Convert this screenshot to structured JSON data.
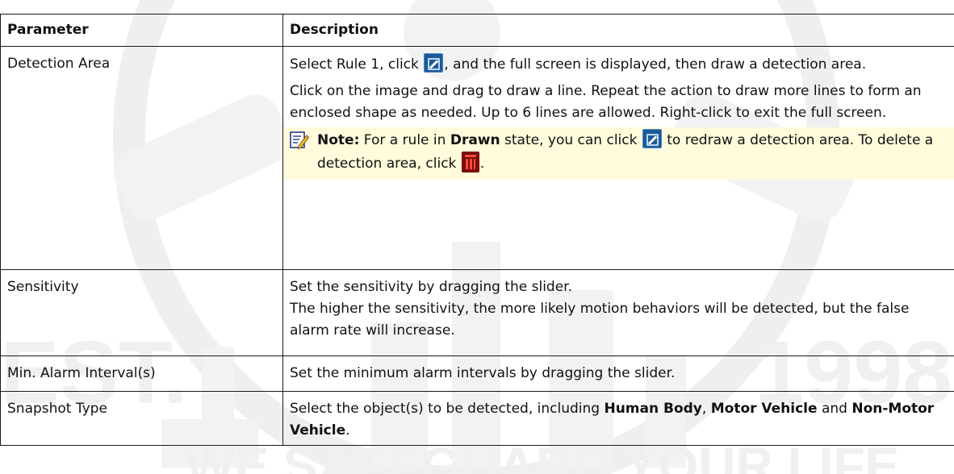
{
  "table": {
    "headers": {
      "parameter": "Parameter",
      "description": "Description"
    },
    "rows": {
      "detection": {
        "parameter": "Detection Area",
        "p1_a": "Select Rule 1, click ",
        "p1_b": ", and the full screen is displayed, then draw a detection area.",
        "p2": "Click on the image and drag to draw a line. Repeat the action to draw more lines to form an enclosed shape as needed. Up to 6 lines are allowed. Right-click to exit the full screen.",
        "note_label": "Note:",
        "note_a": " For a rule in ",
        "note_b": "Drawn",
        "note_c": " state, you can click ",
        "note_d": " to redraw a detection area. To delete a detection area, click ",
        "note_e": "."
      },
      "sensitivity": {
        "parameter": "Sensitivity",
        "p1": "Set the sensitivity by dragging the slider.",
        "p2": "The higher the sensitivity, the more likely motion behaviors will be detected, but the false alarm rate will increase."
      },
      "min_interval": {
        "parameter": "Min. Alarm Interval(s)",
        "p1": "Set the minimum alarm intervals by dragging the slider."
      },
      "snapshot": {
        "parameter": "Snapshot Type",
        "a": "Select the object(s) to be detected, including ",
        "b": "Human Body",
        "c": ", ",
        "d": "Motor Vehicle",
        "e": " and ",
        "f": "Non-Motor Vehicle",
        "g": "."
      }
    }
  },
  "icons": {
    "edit": "edit-area-icon",
    "delete": "delete-area-icon",
    "note": "note-pencil-icon"
  },
  "colors": {
    "note_background": "#fffbdc",
    "edit_icon": "#1c5a98",
    "delete_icon": "#7a0d0d",
    "watermark": "#eeeeee"
  },
  "watermark": {
    "year": "1998",
    "word": "EST.",
    "slogan": "WE SAFEGUARD YOUR LIFE"
  }
}
